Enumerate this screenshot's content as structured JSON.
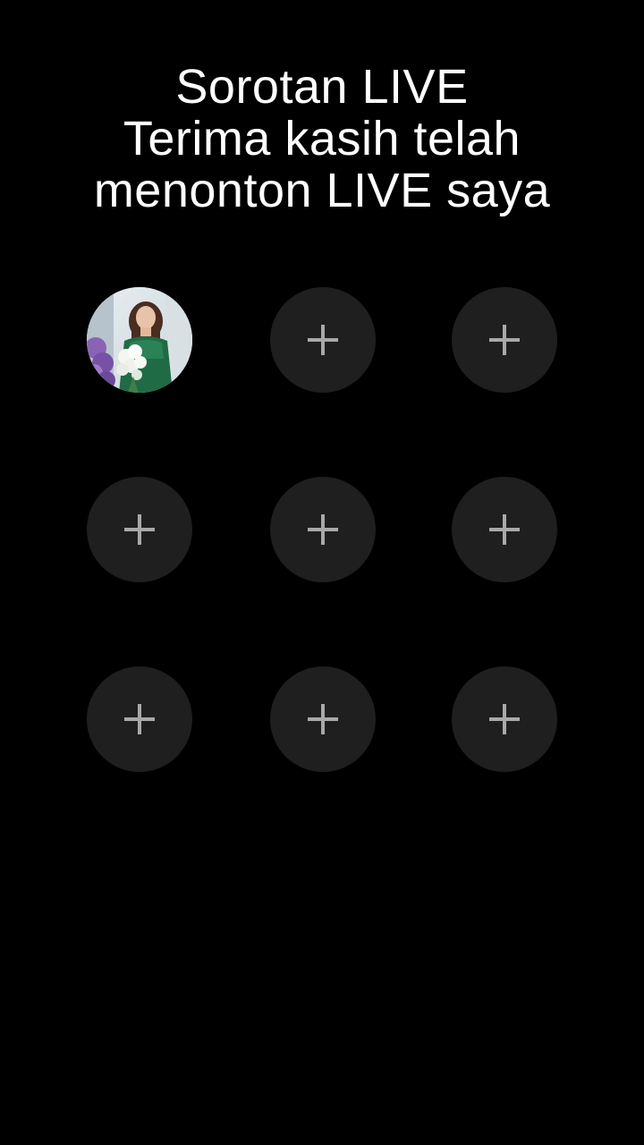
{
  "header": {
    "title_line1": "Sorotan LIVE",
    "title_line2": "Terima kasih telah",
    "title_line3": "menonton LIVE saya"
  },
  "slots": [
    {
      "type": "avatar",
      "icon": "profile-photo"
    },
    {
      "type": "add",
      "icon": "plus-icon"
    },
    {
      "type": "add",
      "icon": "plus-icon"
    },
    {
      "type": "add",
      "icon": "plus-icon"
    },
    {
      "type": "add",
      "icon": "plus-icon"
    },
    {
      "type": "add",
      "icon": "plus-icon"
    },
    {
      "type": "add",
      "icon": "plus-icon"
    },
    {
      "type": "add",
      "icon": "plus-icon"
    },
    {
      "type": "add",
      "icon": "plus-icon"
    }
  ],
  "colors": {
    "background": "#000000",
    "slot": "#1f1f1f",
    "plus": "#a9a9a9",
    "text": "#ffffff"
  }
}
